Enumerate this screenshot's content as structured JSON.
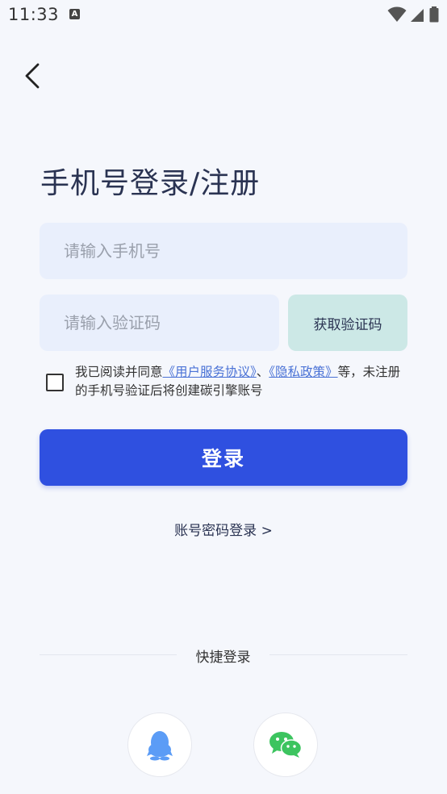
{
  "status_bar": {
    "time": "11:33",
    "notification_icon": "A"
  },
  "header": {
    "back_icon": "chevron-left-icon"
  },
  "title": "手机号登录/注册",
  "phone_input": {
    "placeholder": "请输入手机号",
    "value": ""
  },
  "code_input": {
    "placeholder": "请输入验证码",
    "value": ""
  },
  "get_code_label": "获取验证码",
  "agreement": {
    "prefix": "我已阅读并同意",
    "user_agreement": "《用户服务协议》",
    "separator": "、",
    "privacy_policy": "《隐私政策》",
    "suffix": "等，未注册的手机号验证后将创建碳引擎账号"
  },
  "login_label": "登录",
  "password_login_label": "账号密码登录 >",
  "quick_login_label": "快捷登录",
  "social": [
    {
      "name": "QQ",
      "icon": "qq-penguin-icon",
      "color": "#5b9cf6"
    },
    {
      "name": "WeChat",
      "icon": "wechat-icon",
      "color": "#3cc45f"
    }
  ],
  "colors": {
    "primary": "#2f50e0",
    "link": "#4a72d6",
    "input_bg": "#e9effc",
    "code_button_bg": "#cce8e6",
    "background": "#f5f7fc"
  }
}
